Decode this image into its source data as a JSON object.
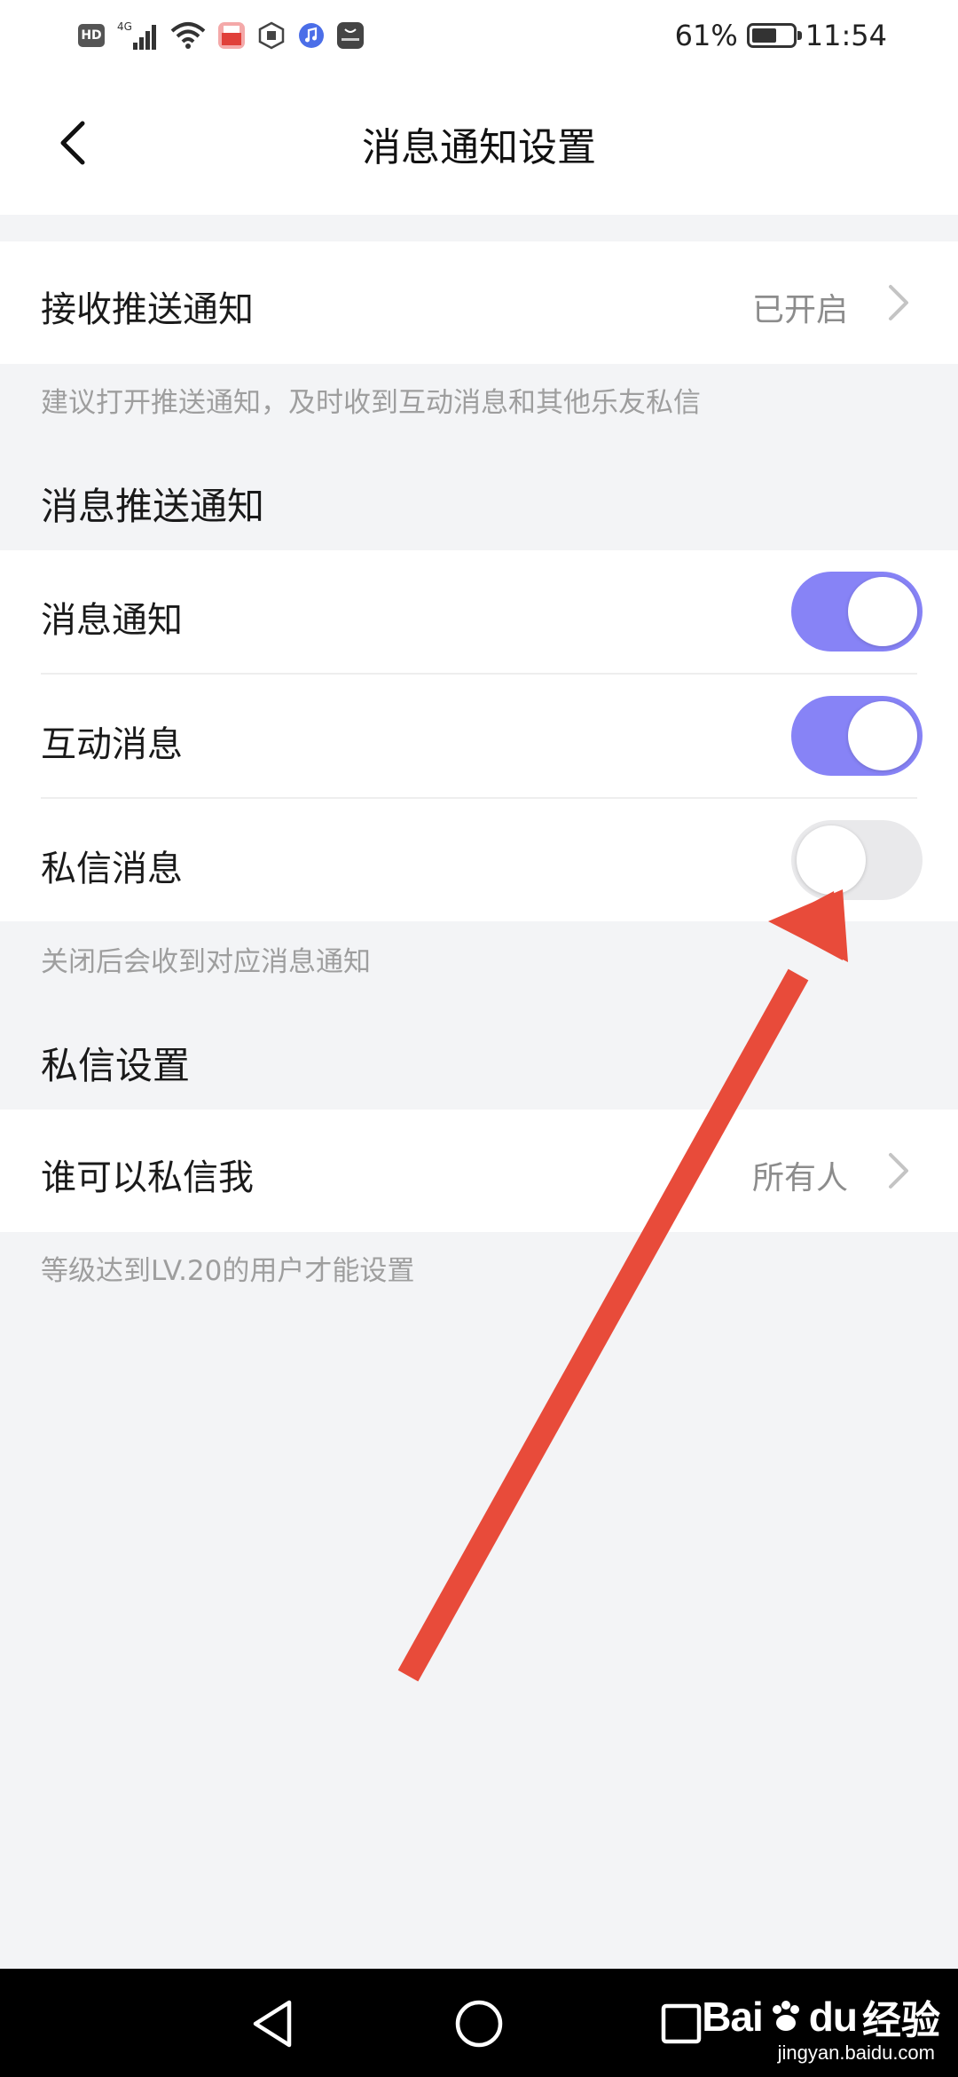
{
  "status_bar": {
    "left_icons": [
      "hd-icon",
      "signal-4g-icon",
      "wifi-icon",
      "app-red-icon",
      "app-hexagon-icon",
      "music-icon",
      "huawei-icon"
    ],
    "signal_label": "4G",
    "hd_label": "HD",
    "battery_percent": "61%",
    "battery_level": 0.61,
    "time": "11:54"
  },
  "header": {
    "title": "消息通知设置",
    "back_icon": "chevron-left-icon"
  },
  "push": {
    "label": "接收推送通知",
    "value": "已开启",
    "hint": "建议打开推送通知，及时收到互动消息和其他乐友私信"
  },
  "message_push": {
    "section_title": "消息推送通知",
    "items": [
      {
        "label": "消息通知",
        "enabled": true
      },
      {
        "label": "互动消息",
        "enabled": true
      },
      {
        "label": "私信消息",
        "enabled": false
      }
    ],
    "hint": "关闭后会收到对应消息通知"
  },
  "dm_settings": {
    "section_title": "私信设置",
    "who_label": "谁可以私信我",
    "who_value": "所有人",
    "hint": "等级达到LV.20的用户才能设置"
  },
  "colors": {
    "toggle_on": "#8783f6",
    "toggle_off": "#e9e9eb",
    "arrow": "#e84b3a",
    "background": "#f3f4f6"
  },
  "nav_bar": {
    "buttons": [
      "back-triangle-icon",
      "home-circle-icon",
      "recents-square-icon"
    ]
  },
  "watermark": {
    "brand": "Bai",
    "brand_suffix": "du",
    "cn_label": "经验",
    "url": "jingyan.baidu.com"
  }
}
